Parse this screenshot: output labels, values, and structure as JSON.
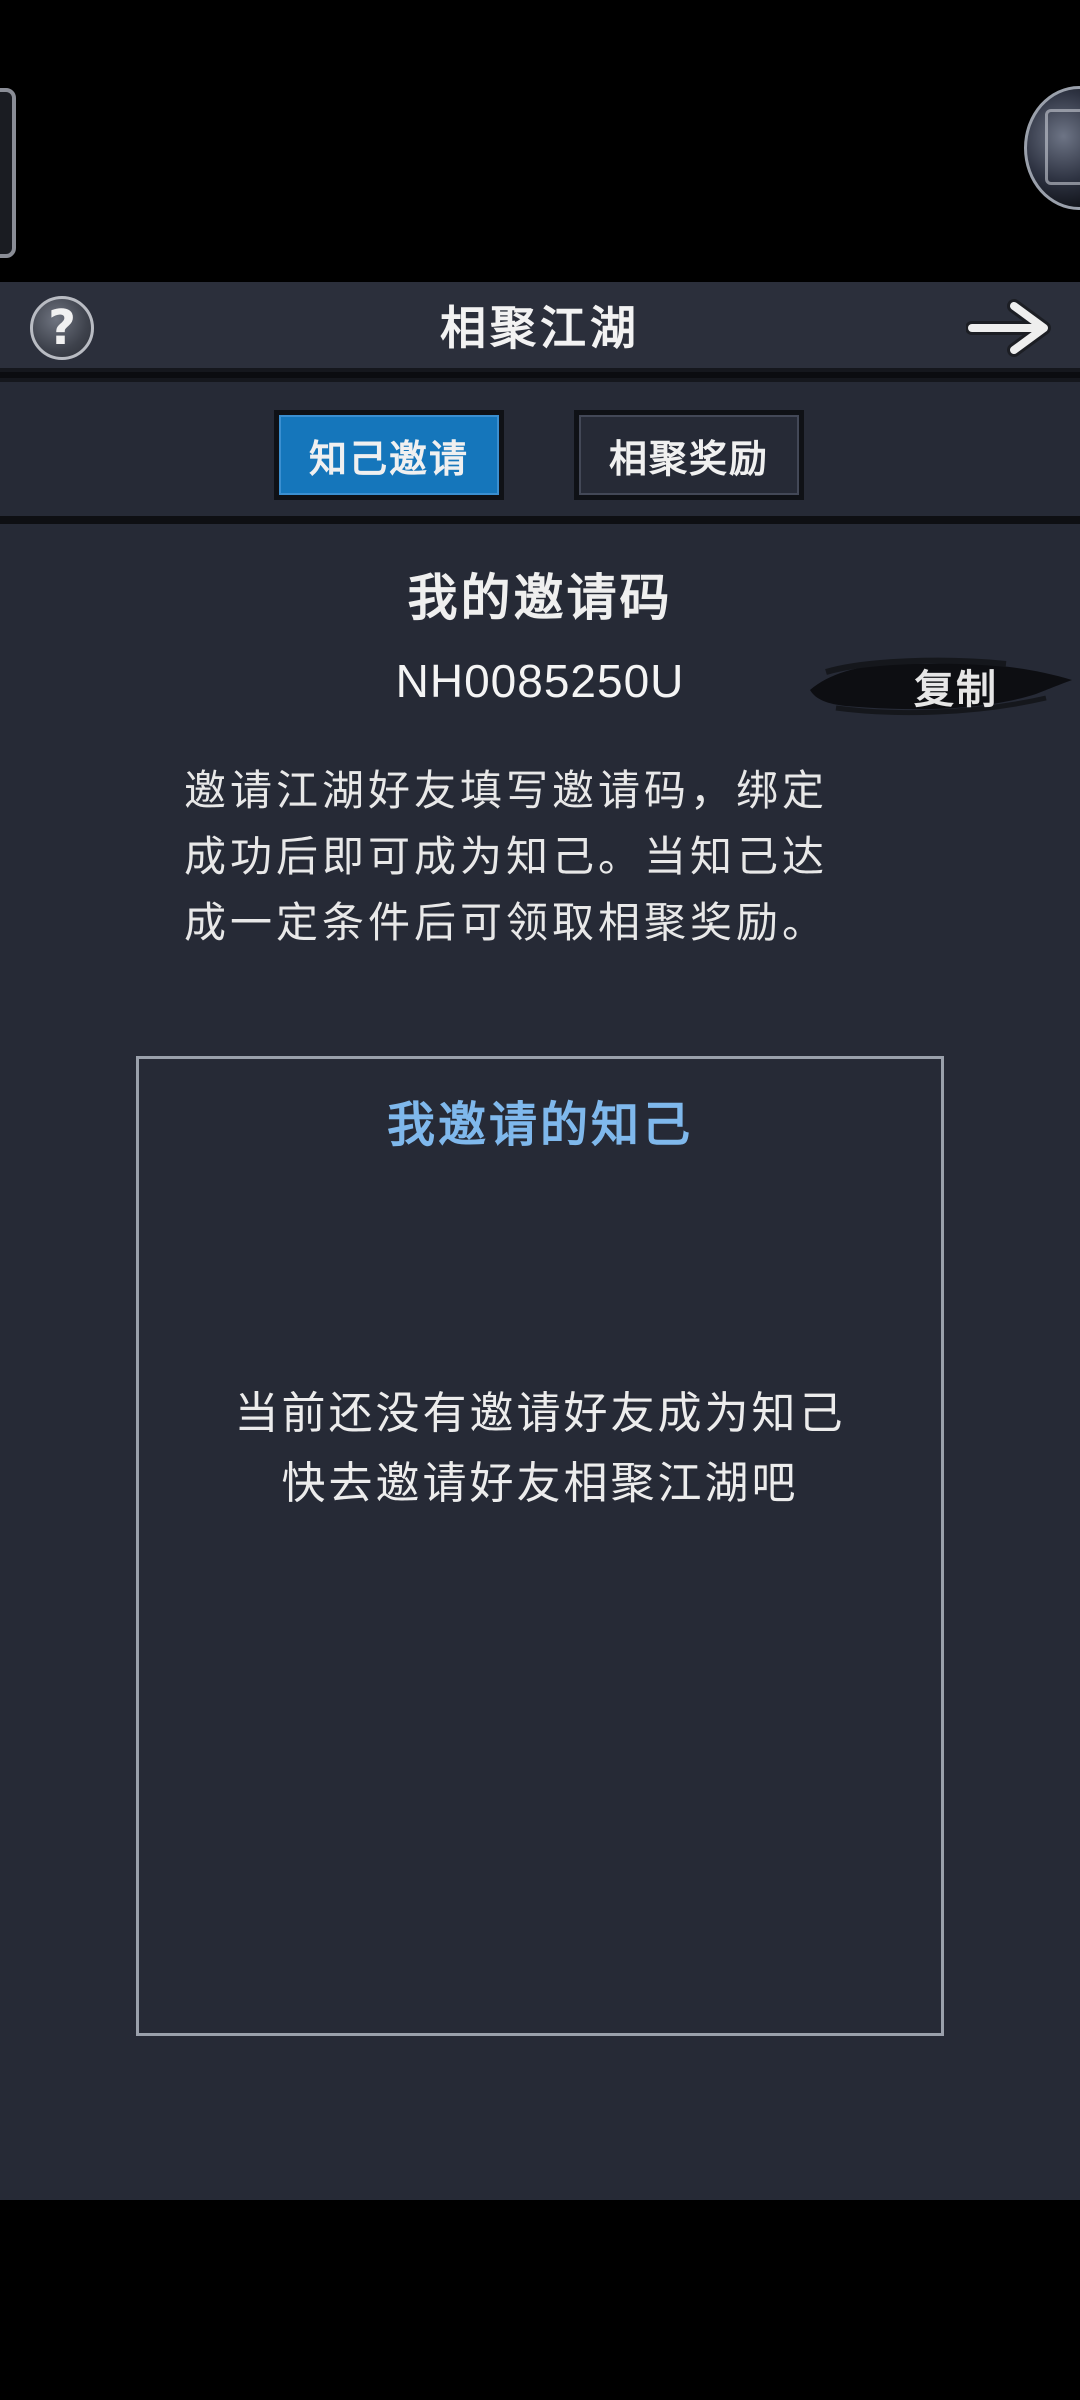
{
  "header": {
    "title": "相聚江湖",
    "help_symbol": "?"
  },
  "tabs": [
    {
      "label": "知己邀请",
      "selected": true
    },
    {
      "label": "相聚奖励",
      "selected": false
    }
  ],
  "invite": {
    "title": "我的邀请码",
    "code": "NH0085250U",
    "copy_label": "复制",
    "description_lines": [
      "邀请江湖好友填写邀请码，绑定",
      "成功后即可成为知己。当知己达",
      "成一定条件后可领取相聚奖励。"
    ]
  },
  "friends": {
    "title": "我邀请的知己",
    "empty_lines": [
      "当前还没有邀请好友成为知己",
      "快去邀请好友相聚江湖吧"
    ]
  },
  "colors": {
    "panel_bg": "#262a36",
    "header_bg": "#2b2f3b",
    "tab_active": "#1576bb",
    "friends_title": "#7fb8ec",
    "border": "#9aa0ab"
  },
  "icons": {
    "help": "question-mark-icon",
    "forward": "arrow-right-icon",
    "copy": "brush-stroke-icon"
  }
}
